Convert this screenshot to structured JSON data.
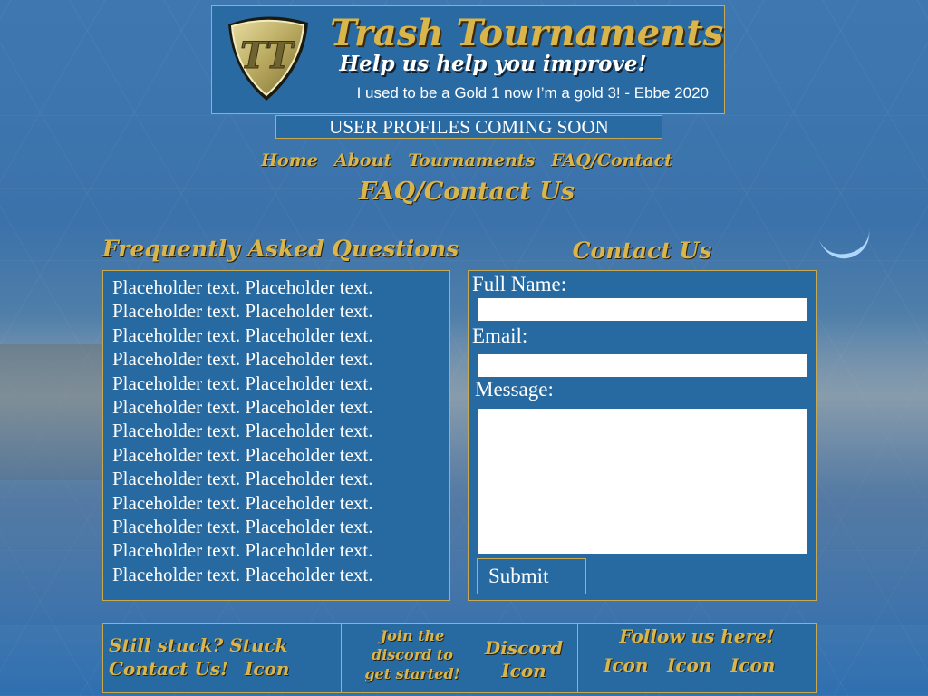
{
  "header": {
    "logo_text": "TT",
    "title": "Trash Tournaments",
    "tagline": "Help us help you improve!",
    "quote": "I used to be a Gold 1 now I’m a gold 3! - Ebbe 2020"
  },
  "banner": "USER PROFILES COMING SOON",
  "nav": {
    "home": "Home",
    "about": "About",
    "tournaments": "Tournaments",
    "faq_contact": "FAQ/Contact"
  },
  "page_heading": "FAQ/Contact Us",
  "faq": {
    "title": "Frequently Asked Questions",
    "lines": [
      "Placeholder text. Placeholder text.",
      "Placeholder text. Placeholder text.",
      "Placeholder text. Placeholder text.",
      "Placeholder text. Placeholder text.",
      "Placeholder text. Placeholder text.",
      "Placeholder text. Placeholder text.",
      "Placeholder text. Placeholder text.",
      "Placeholder text. Placeholder text.",
      "Placeholder text. Placeholder text.",
      "Placeholder text. Placeholder text.",
      "Placeholder text. Placeholder text.",
      "Placeholder text. Placeholder text.",
      "Placeholder text. Placeholder text."
    ]
  },
  "contact": {
    "title": "Contact Us",
    "full_name_label": "Full Name:",
    "full_name_value": "",
    "email_label": "Email:",
    "email_value": "",
    "message_label": "Message:",
    "message_value": "",
    "submit_label": "Submit"
  },
  "footer": {
    "stuck_line1": "Still stuck? Stuck",
    "stuck_line2": "Contact Us!",
    "stuck_icon": "Icon",
    "join_line1": "Join the",
    "join_line2": "discord to",
    "join_line3": "get started!",
    "discord_label": "Discord",
    "discord_icon": "Icon",
    "follow_label": "Follow us here!",
    "social_icons": [
      "Icon",
      "Icon",
      "Icon"
    ]
  },
  "colors": {
    "accent_gold": "#d9b54a",
    "panel_blue": "#276aa1",
    "border_gold": "#c8a94f"
  }
}
